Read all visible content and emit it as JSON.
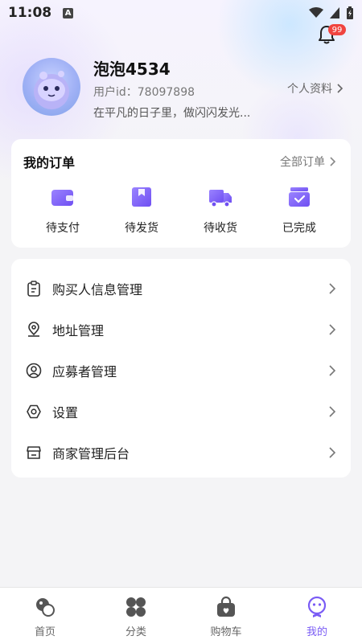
{
  "status_bar": {
    "time": "11:08",
    "badge": "A"
  },
  "notifications": {
    "count": "99"
  },
  "profile": {
    "name": "泡泡4534",
    "user_id": "用户id：78097898",
    "bio": "在平凡的日子里，做闪闪发光...",
    "profile_link": "个人资料"
  },
  "orders": {
    "title": "我的订单",
    "all_label": "全部订单",
    "items": [
      {
        "label": "待支付",
        "icon": "wallet-icon"
      },
      {
        "label": "待发货",
        "icon": "package-icon"
      },
      {
        "label": "待收货",
        "icon": "truck-icon"
      },
      {
        "label": "已完成",
        "icon": "completed-box-icon"
      }
    ]
  },
  "menu": {
    "items": [
      {
        "label": "购买人信息管理",
        "icon": "clipboard-icon"
      },
      {
        "label": "地址管理",
        "icon": "location-pin-icon"
      },
      {
        "label": "应募者管理",
        "icon": "user-circle-icon"
      },
      {
        "label": "设置",
        "icon": "hexagon-settings-icon"
      },
      {
        "label": "商家管理后台",
        "icon": "store-icon"
      }
    ]
  },
  "tabs": [
    {
      "label": "首页",
      "icon": "home-icon"
    },
    {
      "label": "分类",
      "icon": "category-icon"
    },
    {
      "label": "购物车",
      "icon": "cart-bag-icon"
    },
    {
      "label": "我的",
      "icon": "profile-face-icon",
      "active": true
    }
  ],
  "colors": {
    "accent": "#7a5cf5",
    "badge": "#f0443f"
  }
}
